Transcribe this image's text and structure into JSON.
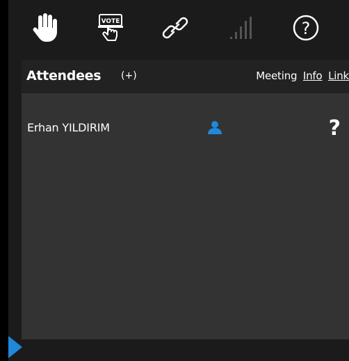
{
  "toolbar": {
    "icons": [
      {
        "name": "raise-hand-icon"
      },
      {
        "name": "vote-icon",
        "label": "VOTE"
      },
      {
        "name": "link-icon"
      },
      {
        "name": "signal-strength-icon"
      },
      {
        "name": "help-icon",
        "label": "?"
      }
    ]
  },
  "attendees": {
    "title": "Attendees",
    "add_label": "(+)",
    "meeting_label": "Meeting",
    "info_link": "Info",
    "link_link": "Link",
    "list": [
      {
        "name": "Erhan YILDIRIM",
        "role_icon": "user-icon",
        "status": "?"
      }
    ]
  },
  "colors": {
    "accent": "#1e88d9",
    "background": "#1b1b1b",
    "header": "#222222",
    "list": "#333333",
    "text": "#ffffff",
    "disabled": "#555555"
  }
}
